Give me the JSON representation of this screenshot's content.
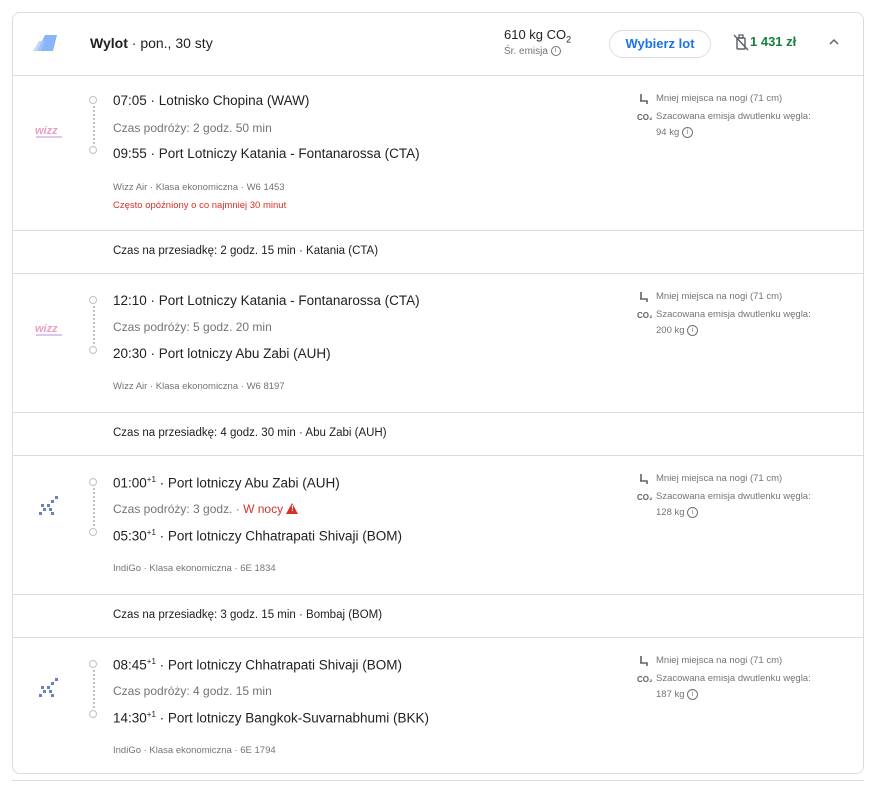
{
  "header": {
    "title_prefix": "Wylot",
    "title_sep": " · ",
    "title_date": "pon., 30 sty",
    "co2_value": "610 kg CO",
    "co2_sub": "2",
    "co2_label": "Śr. emisja",
    "select_label": "Wybierz lot",
    "price": "1 431 zł",
    "colors": {
      "accent": "#1a73e8",
      "price": "#188038",
      "warning": "#d93025"
    }
  },
  "legs": [
    {
      "airline_logo": "wizz-air-logo",
      "dep_time": "07:05",
      "dep_plus": "",
      "dep_airport": "Lotnisko Chopina (WAW)",
      "duration": "Czas podróży: 2 godz. 50 min",
      "night": "",
      "arr_time": "09:55",
      "arr_plus": "",
      "arr_airport": "Port Lotniczy Katania - Fontanarossa (CTA)",
      "meta": "Wizz Air · Klasa ekonomiczna · W6 1453",
      "delay": "Często opóźniony o co najmniej 30 minut",
      "legroom": "Mniej miejsca na nogi (71 cm)",
      "emission_label": "Szacowana emisja dwutlenku węgla:",
      "emission_value": "94 kg"
    },
    {
      "airline_logo": "wizz-air-logo",
      "dep_time": "12:10",
      "dep_plus": "",
      "dep_airport": "Port Lotniczy Katania - Fontanarossa (CTA)",
      "duration": "Czas podróży: 5 godz. 20 min",
      "night": "",
      "arr_time": "20:30",
      "arr_plus": "",
      "arr_airport": "Port lotniczy Abu Zabi (AUH)",
      "meta": "Wizz Air · Klasa ekonomiczna · W6 8197",
      "delay": "",
      "legroom": "Mniej miejsca na nogi (71 cm)",
      "emission_label": "Szacowana emisja dwutlenku węgla:",
      "emission_value": "200 kg"
    },
    {
      "airline_logo": "indigo-logo",
      "dep_time": "01:00",
      "dep_plus": "+1",
      "dep_airport": "Port lotniczy Abu Zabi (AUH)",
      "duration": "Czas podróży: 3 godz.",
      "night": "W nocy",
      "arr_time": "05:30",
      "arr_plus": "+1",
      "arr_airport": "Port lotniczy Chhatrapati Shivaji (BOM)",
      "meta": "IndiGo · Klasa ekonomiczna · 6E 1834",
      "delay": "",
      "legroom": "Mniej miejsca na nogi (71 cm)",
      "emission_label": "Szacowana emisja dwutlenku węgla:",
      "emission_value": "128 kg"
    },
    {
      "airline_logo": "indigo-logo",
      "dep_time": "08:45",
      "dep_plus": "+1",
      "dep_airport": "Port lotniczy Chhatrapati Shivaji (BOM)",
      "duration": "Czas podróży: 4 godz. 15 min",
      "night": "",
      "arr_time": "14:30",
      "arr_plus": "+1",
      "arr_airport": "Port lotniczy Bangkok-Suvarnabhumi (BKK)",
      "meta": "IndiGo · Klasa ekonomiczna · 6E 1794",
      "delay": "",
      "legroom": "Mniej miejsca na nogi (71 cm)",
      "emission_label": "Szacowana emisja dwutlenku węgla:",
      "emission_value": "187 kg"
    }
  ],
  "layovers": [
    "Czas na przesiadkę: 2 godz. 15 min · Katania (CTA)",
    "Czas na przesiadkę: 4 godz. 30 min · Abu Zabi (AUH)",
    "Czas na przesiadkę: 3 godz. 15 min · Bombaj (BOM)"
  ],
  "common": {
    "sep": " · ",
    "co2_icon_text": "CO₂",
    "info_glyph": "i"
  }
}
